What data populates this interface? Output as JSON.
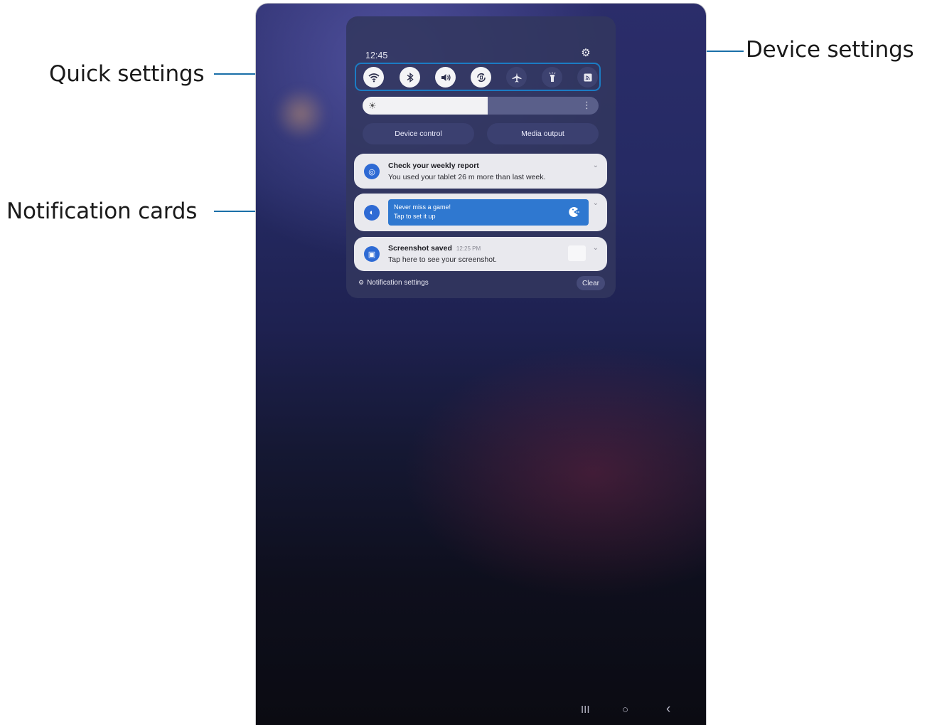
{
  "callouts": {
    "quick_settings": "Quick settings",
    "notification_cards": "Notification cards",
    "device_settings": "Device settings"
  },
  "status": {
    "time": "12:45",
    "settings_icon": "gear-icon"
  },
  "quick_settings": [
    {
      "name": "wifi",
      "icon": "wifi-icon",
      "state": "on"
    },
    {
      "name": "bluetooth",
      "icon": "bluetooth-icon",
      "state": "on"
    },
    {
      "name": "sound",
      "icon": "volume-icon",
      "state": "on"
    },
    {
      "name": "auto-rotate",
      "icon": "rotate-icon",
      "state": "on"
    },
    {
      "name": "airplane",
      "icon": "airplane-icon",
      "state": "off"
    },
    {
      "name": "flashlight",
      "icon": "flashlight-icon",
      "state": "off"
    },
    {
      "name": "cast",
      "icon": "cast-icon",
      "state": "off"
    }
  ],
  "brightness": {
    "level": 0.53
  },
  "buttons": {
    "device_control": "Device control",
    "media_output": "Media output"
  },
  "notifications": [
    {
      "title": "Check your weekly report",
      "body": "You used your tablet 26 m more than last week."
    },
    {
      "title": "Never miss a game!",
      "body": "Tap to set it up"
    },
    {
      "title": "Screenshot saved",
      "time": "12:25 PM",
      "body": "Tap here to see your screenshot."
    }
  ],
  "footer": {
    "notification_settings": "Notification settings",
    "clear": "Clear"
  },
  "nav": {
    "recents": "III",
    "home": "○",
    "back": "‹"
  },
  "colors": {
    "callout_line": "#1a6fa8",
    "highlight_border": "#1b7cc4",
    "accent_blue": "#2f78d0"
  }
}
